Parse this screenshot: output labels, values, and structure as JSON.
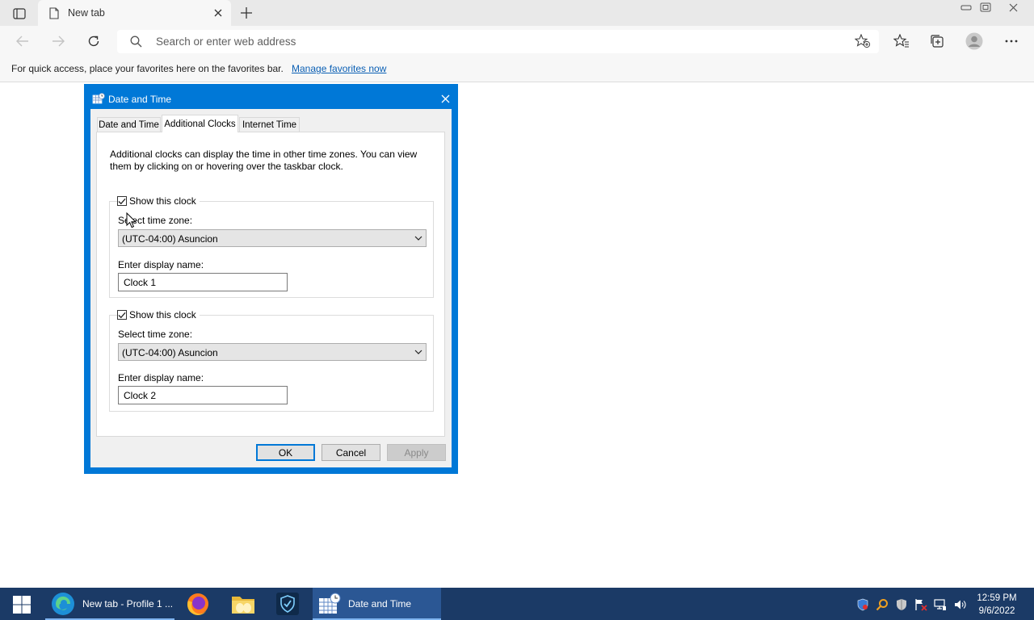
{
  "browser": {
    "tab_title": "New tab",
    "omnibox_placeholder": "Search or enter web address",
    "favorites_bar": {
      "message": "For quick access, place your favorites here on the favorites bar.",
      "link": "Manage favorites now"
    }
  },
  "dialog": {
    "title": "Date and Time",
    "tabs": [
      {
        "label": "Date and Time"
      },
      {
        "label": "Additional Clocks"
      },
      {
        "label": "Internet Time"
      }
    ],
    "description": "Additional clocks can display the time in other time zones. You can view them by clicking on or hovering over the taskbar clock.",
    "clocks": [
      {
        "show_label": "Show this clock",
        "checked": true,
        "timezone_label": "Select time zone:",
        "timezone_value": "(UTC-04:00) Asuncion",
        "name_label": "Enter display name:",
        "name_value": "Clock 1"
      },
      {
        "show_label": "Show this clock",
        "checked": true,
        "timezone_label": "Select time zone:",
        "timezone_value": "(UTC-04:00) Asuncion",
        "name_label": "Enter display name:",
        "name_value": "Clock 2"
      }
    ],
    "buttons": {
      "ok": "OK",
      "cancel": "Cancel",
      "apply": "Apply"
    }
  },
  "taskbar": {
    "edge_label": "New tab - Profile 1 ...",
    "datetime_label": "Date and Time",
    "clock_time": "12:59 PM",
    "clock_date": "9/6/2022"
  },
  "colors": {
    "accent": "#0078d7",
    "taskbar": "#1b3a66",
    "link": "#0a5fb4"
  }
}
